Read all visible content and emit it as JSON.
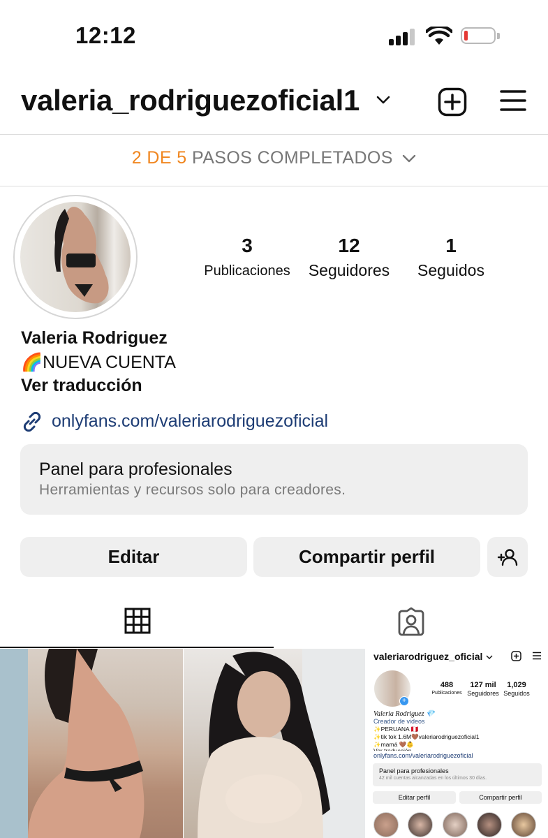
{
  "status_bar": {
    "time": "12:12"
  },
  "header": {
    "username": "valeria_rodriguezoficial1"
  },
  "steps": {
    "highlight": "2 DE 5",
    "rest": "PASOS COMPLETADOS"
  },
  "profile": {
    "stats": [
      {
        "num": "3",
        "label": "Publicaciones"
      },
      {
        "num": "12",
        "label": "Seguidores"
      },
      {
        "num": "1",
        "label": "Seguidos"
      }
    ],
    "name": "Valeria Rodriguez",
    "bio": "🌈NUEVA CUENTA",
    "translate": "Ver traducción",
    "link": "onlyfans.com/valeriarodriguezoficial"
  },
  "panel": {
    "title": "Panel para profesionales",
    "subtitle": "Herramientas y recursos solo para creadores."
  },
  "buttons": {
    "edit": "Editar",
    "share": "Compartir perfil"
  },
  "tabs": [
    "grid-icon",
    "tagged-icon"
  ],
  "mini": {
    "username": "valeriarodriguez_oficial",
    "stats": [
      {
        "num": "488",
        "label": "Publicaciones"
      },
      {
        "num": "127 mil",
        "label": "Seguidores"
      },
      {
        "num": "1,029",
        "label": "Seguidos"
      }
    ],
    "name": "Valeria Rodriguez 💎",
    "category": "Creador de videos",
    "bio1": "✨PERUANA 🇵🇪",
    "bio2": "✨tik tok 1.6M🤎valeriarodriguezoficial1",
    "bio3": "✨mamá 🤎👶",
    "translate": "Ver traducción",
    "link": "onlyfans.com/valeriarodriguezoficial",
    "panel_title": "Panel para profesionales",
    "panel_sub": "42 mil cuentas alcanzadas en los últimos 30 días.",
    "edit": "Editar perfil",
    "share": "Compartir perfil"
  },
  "colors": {
    "accent_orange": "#f0861f",
    "link_blue": "#1d3c74",
    "battery_red": "#e53935"
  }
}
